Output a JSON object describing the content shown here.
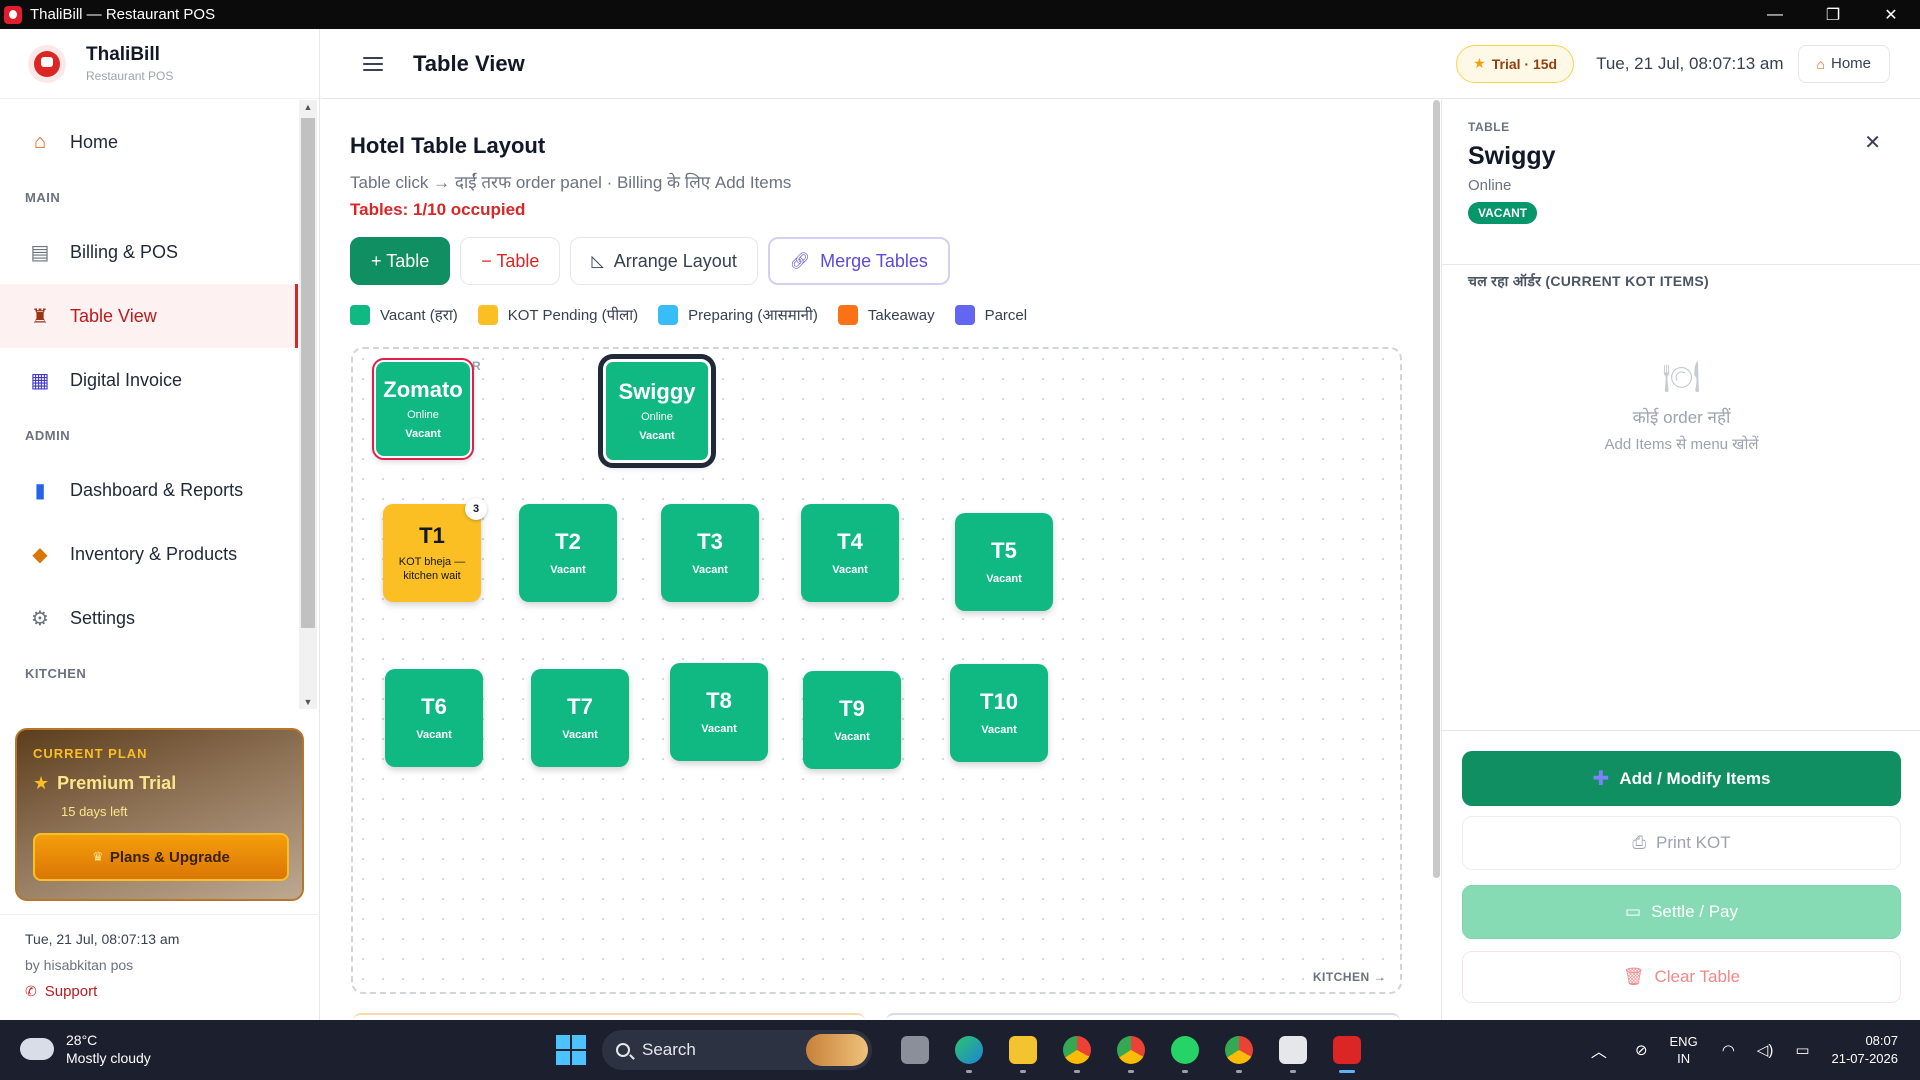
{
  "window": {
    "title": "ThaliBill — Restaurant POS",
    "controls": [
      "—",
      "❐",
      "✕"
    ]
  },
  "brand": {
    "name": "ThaliBill",
    "subtitle": "Restaurant POS"
  },
  "sidebar": {
    "home": {
      "label": "Home",
      "icon": "home-icon"
    },
    "sections": {
      "main": "MAIN",
      "admin": "ADMIN",
      "kitchen": "KITCHEN"
    },
    "items": [
      {
        "label": "Billing & POS",
        "icon": "receipt-icon"
      },
      {
        "label": "Table View",
        "icon": "chair-icon",
        "active": true
      },
      {
        "label": "Digital Invoice",
        "icon": "calculator-icon"
      },
      {
        "label": "Dashboard & Reports",
        "icon": "bar-chart-icon"
      },
      {
        "label": "Inventory & Products",
        "icon": "box-icon"
      },
      {
        "label": "Settings",
        "icon": "gear-icon"
      }
    ],
    "plan": {
      "label": "CURRENT PLAN",
      "title": "Premium Trial",
      "days_left": "15 days left",
      "button": "Plans & Upgrade"
    },
    "footer": {
      "datetime": "Tue, 21 Jul, 08:07:13 am",
      "by": "by hisabkitan pos",
      "support": "Support"
    }
  },
  "header": {
    "title": "Table View",
    "trial_badge": "Trial · 15d",
    "datetime": "Tue, 21 Jul, 08:07:13 am",
    "home_button": "Home"
  },
  "main": {
    "title": "Hotel Table Layout",
    "subtitle": "Table click → दाईं तरफ order panel · Billing के लिए Add Items",
    "occupancy": "Tables: 1/10 occupied",
    "buttons": {
      "add_table": "+ Table",
      "remove_table": "− Table",
      "arrange_layout": "Arrange Layout",
      "merge_tables": "Merge Tables"
    },
    "legend": [
      {
        "label": "Vacant (हरा)",
        "color": "#10b981"
      },
      {
        "label": "KOT Pending (पीला)",
        "color": "#fbbf24"
      },
      {
        "label": "Preparing (आसमानी)",
        "color": "#38bdf8"
      },
      {
        "label": "Takeaway",
        "color": "#f97316"
      },
      {
        "label": "Parcel",
        "color": "#6366f1"
      }
    ],
    "floor": {
      "top_label": "ER",
      "bottom_label": "KITCHEN →"
    },
    "tables": {
      "zomato": {
        "name": "Zomato",
        "type": "Online",
        "status": "Vacant"
      },
      "swiggy": {
        "name": "Swiggy",
        "type": "Online",
        "status": "Vacant"
      },
      "t1": {
        "name": "T1",
        "status": "KOT bheja — kitchen wait",
        "badge": "3"
      },
      "t2": {
        "name": "T2",
        "status": "Vacant"
      },
      "t3": {
        "name": "T3",
        "status": "Vacant"
      },
      "t4": {
        "name": "T4",
        "status": "Vacant"
      },
      "t5": {
        "name": "T5",
        "status": "Vacant"
      },
      "t6": {
        "name": "T6",
        "status": "Vacant"
      },
      "t7": {
        "name": "T7",
        "status": "Vacant"
      },
      "t8": {
        "name": "T8",
        "status": "Vacant"
      },
      "t9": {
        "name": "T9",
        "status": "Vacant"
      },
      "t10": {
        "name": "T10",
        "status": "Vacant"
      }
    }
  },
  "panel": {
    "label": "TABLE",
    "name": "Swiggy",
    "type": "Online",
    "status": "VACANT",
    "section_title": "चल रहा ऑर्डर (CURRENT KOT ITEMS)",
    "empty_title": "कोई order नहीं",
    "empty_hint": "Add Items से menu खोलें",
    "buttons": {
      "add": "Add / Modify Items",
      "print": "Print KOT",
      "settle": "Settle / Pay",
      "clear": "Clear Table"
    }
  },
  "taskbar": {
    "weather_temp": "28°C",
    "weather_desc": "Mostly cloudy",
    "search": "Search",
    "lang_1": "ENG",
    "lang_2": "IN",
    "time": "08:07",
    "date": "21-07-2026"
  }
}
